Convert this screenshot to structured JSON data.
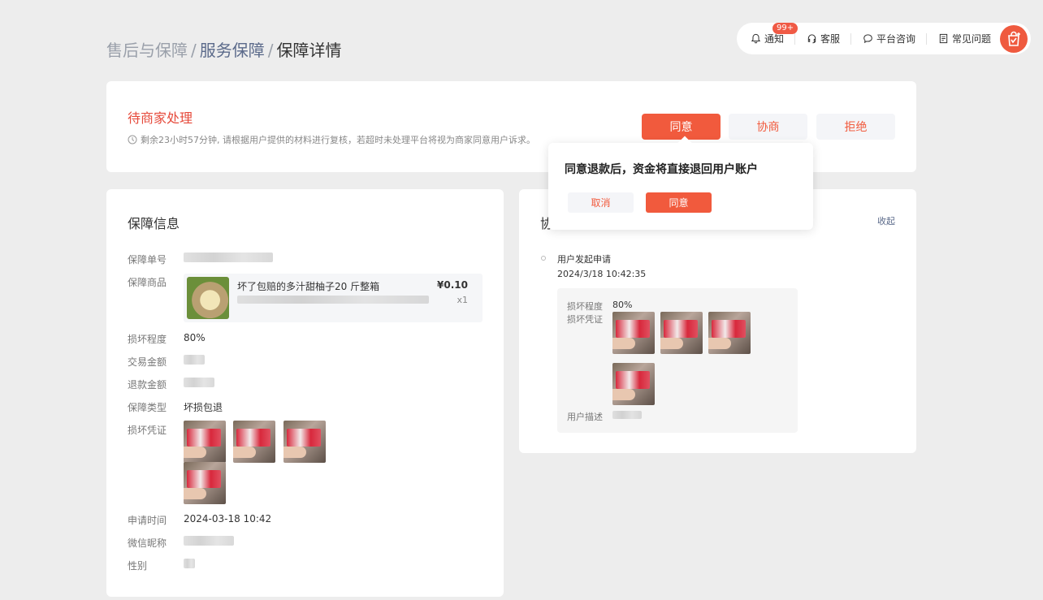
{
  "breadcrumb": {
    "level1": "售后与保障",
    "level2": "服务保障",
    "level3": "保障详情",
    "separator": "/"
  },
  "topbar": {
    "notice_label": "通知",
    "notice_badge": "99+",
    "service_label": "客服",
    "consult_label": "平台咨询",
    "faq_label": "常见问题"
  },
  "status": {
    "title": "待商家处理",
    "desc": "剩余23小时57分钟, 请根据用户提供的材料进行复核，若超时未处理平台将视为商家同意用户诉求。",
    "agree_label": "同意",
    "negotiate_label": "协商",
    "reject_label": "拒绝"
  },
  "popover": {
    "message": "同意退款后，资金将直接退回用户账户",
    "cancel_label": "取消",
    "confirm_label": "同意"
  },
  "info": {
    "title": "保障信息",
    "order_no_label": "保障单号",
    "product_label": "保障商品",
    "product_name": "坏了包赔的多汁甜柚子20 斤整箱",
    "product_price": "¥0.10",
    "product_qty": "x1",
    "damage_label": "损坏程度",
    "damage_value": "80%",
    "trade_amount_label": "交易金额",
    "refund_amount_label": "退款金额",
    "type_label": "保障类型",
    "type_value": "坏损包退",
    "evidence_label": "损坏凭证",
    "apply_time_label": "申请时间",
    "apply_time_value": "2024-03-18 10:42",
    "wechat_label": "微信昵称",
    "gender_label": "性别"
  },
  "negotiation": {
    "title_partial": "协",
    "collapse_label": "收起",
    "event_title": "用户发起申请",
    "event_time": "2024/3/18 10:42:35",
    "damage_label": "损坏程度",
    "damage_value": "80%",
    "evidence_label": "损坏凭证",
    "desc_label": "用户描述"
  },
  "colors": {
    "accent": "#f15a3d",
    "status_red": "#e64a3b",
    "link_blue": "#5b6a8a",
    "background": "#ededed"
  }
}
